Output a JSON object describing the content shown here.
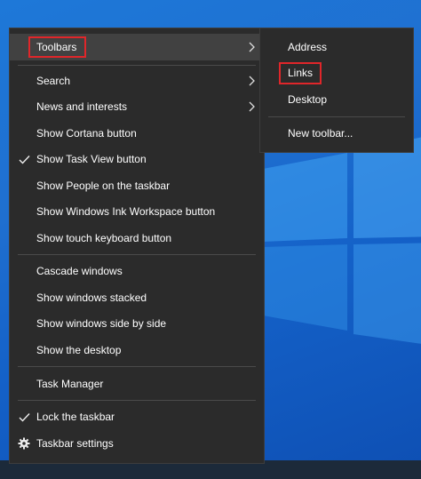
{
  "context_menu": {
    "items": [
      {
        "label": "Toolbars",
        "has_submenu": true,
        "checked": false,
        "highlighted": true
      },
      {
        "label": "Search",
        "has_submenu": true,
        "checked": false
      },
      {
        "label": "News and interests",
        "has_submenu": true,
        "checked": false
      },
      {
        "label": "Show Cortana button",
        "has_submenu": false,
        "checked": false
      },
      {
        "label": "Show Task View button",
        "has_submenu": false,
        "checked": true
      },
      {
        "label": "Show People on the taskbar",
        "has_submenu": false,
        "checked": false
      },
      {
        "label": "Show Windows Ink Workspace button",
        "has_submenu": false,
        "checked": false
      },
      {
        "label": "Show touch keyboard button",
        "has_submenu": false,
        "checked": false
      },
      {
        "label": "Cascade windows",
        "has_submenu": false,
        "checked": false
      },
      {
        "label": "Show windows stacked",
        "has_submenu": false,
        "checked": false
      },
      {
        "label": "Show windows side by side",
        "has_submenu": false,
        "checked": false
      },
      {
        "label": "Show the desktop",
        "has_submenu": false,
        "checked": false
      },
      {
        "label": "Task Manager",
        "has_submenu": false,
        "checked": false
      },
      {
        "label": "Lock the taskbar",
        "has_submenu": false,
        "checked": true
      },
      {
        "label": "Taskbar settings",
        "has_submenu": false,
        "icon": "gear-icon"
      }
    ]
  },
  "toolbars_submenu": {
    "items": [
      {
        "label": "Address"
      },
      {
        "label": "Links",
        "highlighted": true
      },
      {
        "label": "Desktop"
      },
      {
        "label": "New toolbar..."
      }
    ]
  },
  "colors": {
    "menu_background": "#2b2b2b",
    "hover_background": "#414141",
    "highlight_border": "#e0262a",
    "desktop_blue": "#1e78d8"
  }
}
